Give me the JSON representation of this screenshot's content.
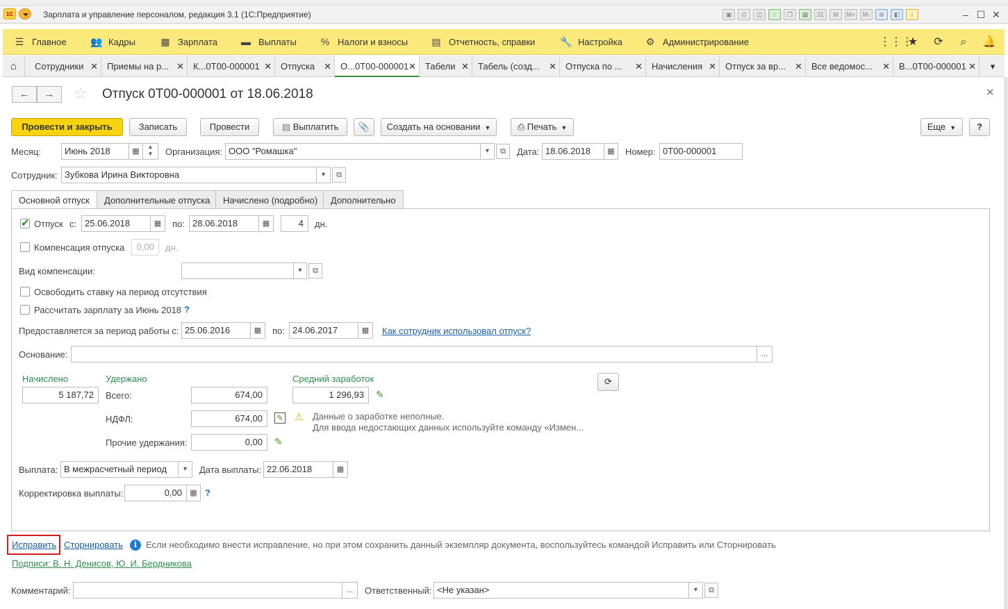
{
  "window": {
    "title": "Зарплата и управление персоналом, редакция 3.1  (1С:Предприятие)",
    "logo_text": "1С"
  },
  "main_menu": [
    {
      "label": "Главное",
      "icon": "hamburger-icon"
    },
    {
      "label": "Кадры",
      "icon": "people-icon"
    },
    {
      "label": "Зарплата",
      "icon": "calculator-icon"
    },
    {
      "label": "Выплаты",
      "icon": "card-icon"
    },
    {
      "label": "Налоги и взносы",
      "icon": "percent-icon"
    },
    {
      "label": "Отчетность, справки",
      "icon": "report-icon"
    },
    {
      "label": "Настройка",
      "icon": "wrench-icon"
    },
    {
      "label": "Администрирование",
      "icon": "gear-icon"
    }
  ],
  "tabs": [
    {
      "label": "Сотрудники"
    },
    {
      "label": "Приемы на р..."
    },
    {
      "label": "К...0Т00-000001"
    },
    {
      "label": "Отпуска"
    },
    {
      "label": "О...0Т00-000001"
    },
    {
      "label": "Табели"
    },
    {
      "label": "Табель (созд..."
    },
    {
      "label": "Отпуска по ..."
    },
    {
      "label": "Начисления"
    },
    {
      "label": "Отпуск за вр..."
    },
    {
      "label": "Все ведомос..."
    },
    {
      "label": "В...0Т00-000001"
    }
  ],
  "document": {
    "title": "Отпуск 0Т00-000001 от 18.06.2018"
  },
  "toolbar": {
    "post_close": "Провести и закрыть",
    "save": "Записать",
    "post": "Провести",
    "pay": "Выплатить",
    "create_based": "Создать на основании",
    "print": "Печать",
    "more": "Еще",
    "help": "?"
  },
  "header": {
    "month_label": "Месяц:",
    "month_value": "Июнь 2018",
    "org_label": "Организация:",
    "org_value": "ООО \"Ромашка\"",
    "date_label": "Дата:",
    "date_value": "18.06.2018",
    "number_label": "Номер:",
    "number_value": "0Т00-000001",
    "employee_label": "Сотрудник:",
    "employee_value": "Зубкова Ирина Викторовна"
  },
  "form_tabs": [
    "Основной отпуск",
    "Дополнительные отпуска",
    "Начислено (подробно)",
    "Дополнительно"
  ],
  "vacation": {
    "vacation_label": "Отпуск",
    "from_label": "с:",
    "from_value": "25.06.2018",
    "to_label": "по:",
    "to_value": "28.06.2018",
    "days_value": "4",
    "days_unit": "дн.",
    "compensation_label": "Компенсация отпуска",
    "compensation_value": "0,00",
    "compensation_unit": "дн.",
    "comp_type_label": "Вид компенсации:",
    "free_rate_label": "Освободить ставку на период отсутствия",
    "calc_salary_label": "Рассчитать зарплату за Июнь 2018",
    "period_label": "Предоставляется за период работы с:",
    "period_from": "25.06.2016",
    "period_to_label": "по:",
    "period_to": "24.06.2017",
    "usage_link": "Как сотрудник использовал отпуск?",
    "basis_label": "Основание:",
    "basis_value": ""
  },
  "amounts": {
    "accrued_head": "Начислено",
    "accrued_value": "5 187,72",
    "withheld_head": "Удержано",
    "total_label": "Всего:",
    "total_value": "674,00",
    "ndfl_label": "НДФЛ:",
    "ndfl_value": "674,00",
    "other_label": "Прочие удержания:",
    "other_value": "0,00",
    "avg_head": "Средний заработок",
    "avg_value": "1 296,93",
    "warning_line1": "Данные о заработке неполные.",
    "warning_line2": "Для ввода недостающих данных используйте команду «Измен..."
  },
  "payment": {
    "payment_label": "Выплата:",
    "payment_value": "В межрасчетный период",
    "pay_date_label": "Дата выплаты:",
    "pay_date_value": "22.06.2018",
    "correction_label": "Корректировка выплаты:",
    "correction_value": "0,00"
  },
  "footer": {
    "fix_link": "Исправить",
    "reverse_link": "Сторнировать",
    "info_text": "Если необходимо внести исправление, но при этом сохранить данный экземпляр документа, воспользуйтесь командой Исправить или Сторнировать",
    "signatures_link": "Подписи: В. Н. Денисов, Ю. И. Бердникова",
    "comment_label": "Комментарий:",
    "comment_value": "",
    "responsible_label": "Ответственный:",
    "responsible_value": "<Не указан>"
  },
  "colors": {
    "menu_bg": "#fbe97c",
    "primary_button": "#f7d40f",
    "green_text": "#2f8f4f",
    "link_blue": "#1a5fa8",
    "highlight_red": "#d61c1c"
  }
}
